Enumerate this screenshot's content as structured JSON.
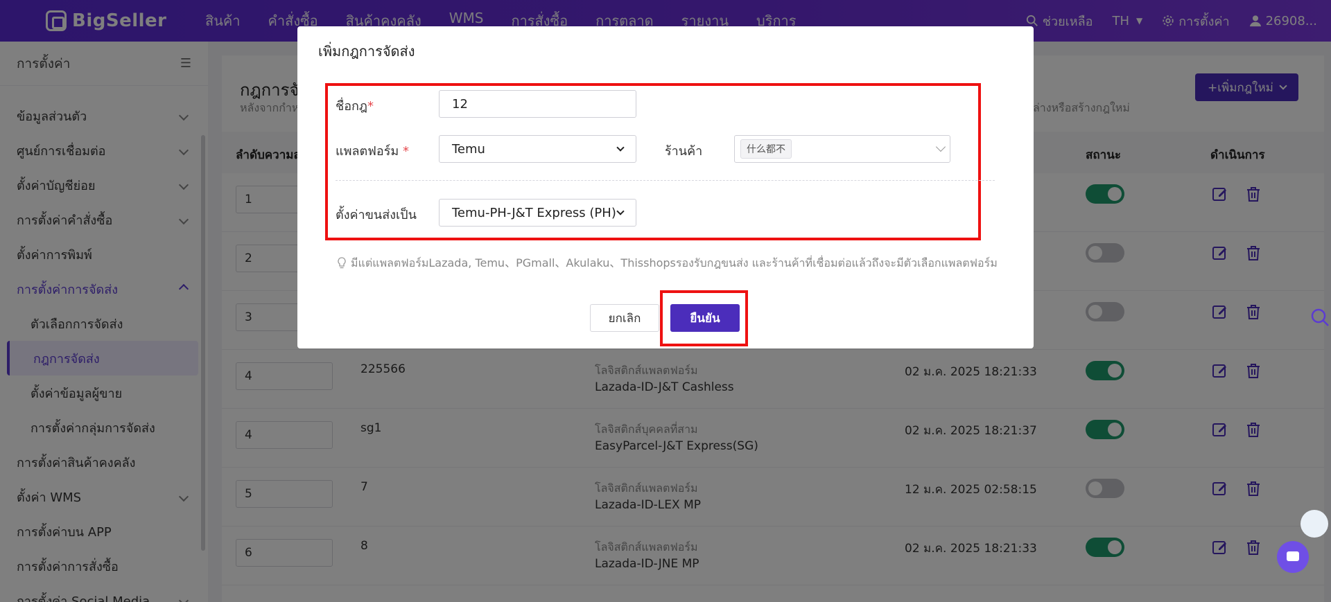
{
  "topbar": {
    "logo": "BigSeller",
    "nav": [
      "สินค้า",
      "คำสั่งซื้อ",
      "สินค้าคงคลัง",
      "WMS",
      "การสั่งซื้อ",
      "การตลาด",
      "รายงาน",
      "บริการ"
    ],
    "help": "ช่วยเหลือ",
    "lang": "TH",
    "settings": "การตั้งค่า",
    "user": "26908..."
  },
  "sidebar": {
    "title": "การตั้งค่า",
    "items": [
      {
        "label": "ข้อมูลส่วนตัว",
        "chevron": true
      },
      {
        "label": "ศูนย์การเชื่อมต่อ",
        "chevron": true
      },
      {
        "label": "ตั้งค่าบัญชีย่อย",
        "chevron": true
      },
      {
        "label": "การตั้งค่าคำสั่งซื้อ",
        "chevron": true
      },
      {
        "label": "ตั้งค่าการพิมพ์",
        "chevron": false
      },
      {
        "label": "การตั้งค่าการจัดส่ง",
        "chevron": true,
        "expanded": true
      }
    ],
    "sub_items": [
      "ตัวเลือกการจัดส่ง",
      "กฎการจัดส่ง",
      "ตั้งค่าข้อมูลผู้ขาย",
      "การตั้งค่ากลุ่มการจัดส่ง"
    ],
    "items_after": [
      {
        "label": "การตั้งค่าสินค้าคงคลัง",
        "chevron": false
      },
      {
        "label": "ตั้งค่า WMS",
        "chevron": true
      },
      {
        "label": "การตั้งค่าบน APP",
        "chevron": false
      },
      {
        "label": "การตั้งค่าการสั่งซื้อ",
        "chevron": false
      },
      {
        "label": "การตั้งค่า Social Media",
        "chevron": true
      }
    ]
  },
  "page": {
    "title": "กฎการจัด",
    "subtitle": "หลังจากกำห",
    "subtitle_right": "ล่างหรือสร้างกฎใหม่",
    "add_button": "+เพิ่มกฎใหม่"
  },
  "table": {
    "headers": {
      "priority": "ลำดับความสำ",
      "status": "สถานะ",
      "actions": "ดำเนินการ"
    },
    "rows": [
      {
        "priority": "1",
        "name": "",
        "type": "",
        "logistics": "",
        "time": "",
        "on": true
      },
      {
        "priority": "2",
        "name": "",
        "type": "",
        "logistics": "",
        "time": "",
        "on": false
      },
      {
        "priority": "3",
        "name": "",
        "type": "",
        "logistics": "",
        "time": "",
        "on": false
      },
      {
        "priority": "4",
        "name": "225566",
        "type": "โลจิสติกส์แพลตฟอร์ม",
        "logistics": "Lazada-ID-J&T Cashless",
        "time": "02 ม.ค. 2025 18:21:33",
        "on": true
      },
      {
        "priority": "4",
        "name": "sg1",
        "type": "โลจิสติกส์บุคคลที่สาม",
        "logistics": "EasyParcel-J&T Express(SG)",
        "time": "02 ม.ค. 2025 18:21:37",
        "on": true
      },
      {
        "priority": "5",
        "name": "7",
        "type": "โลจิสติกส์แพลตฟอร์ม",
        "logistics": "Lazada-ID-LEX MP",
        "time": "12 ม.ค. 2025 02:58:15",
        "on": false
      },
      {
        "priority": "6",
        "name": "8",
        "type": "โลจิสติกส์แพลตฟอร์ม",
        "logistics": "Lazada-ID-JNE MP",
        "time": "02 ม.ค. 2025 18:21:33",
        "on": true
      }
    ]
  },
  "modal": {
    "title": "เพิ่มกฎการจัดส่ง",
    "rule_name_label": "ชื่อกฎ",
    "rule_name_value": "12",
    "platform_label": "แพลตฟอร์ม",
    "platform_value": "Temu",
    "store_label": "ร้านค้า",
    "store_tag": "什么都不",
    "shipping_label": "ตั้งค่าขนส่งเป็น",
    "shipping_value": "Temu-PH-J&T Express (PH)",
    "hint": "มีแต่แพลตฟอร์มLazada, Temu、PGmall、Akulaku、Thisshopsรองรับกฎขนส่ง และร้านค้าที่เชื่อมต่อแล้วถึงจะมีตัวเลือกแพลตฟอร์ม",
    "cancel": "ยกเลิก",
    "confirm": "ยืนยัน"
  },
  "colors": {
    "brand": "#5a2bd6",
    "primary_button": "#4b2dbb",
    "toggle_on": "#1e9a6d",
    "highlight": "#ee1111"
  }
}
